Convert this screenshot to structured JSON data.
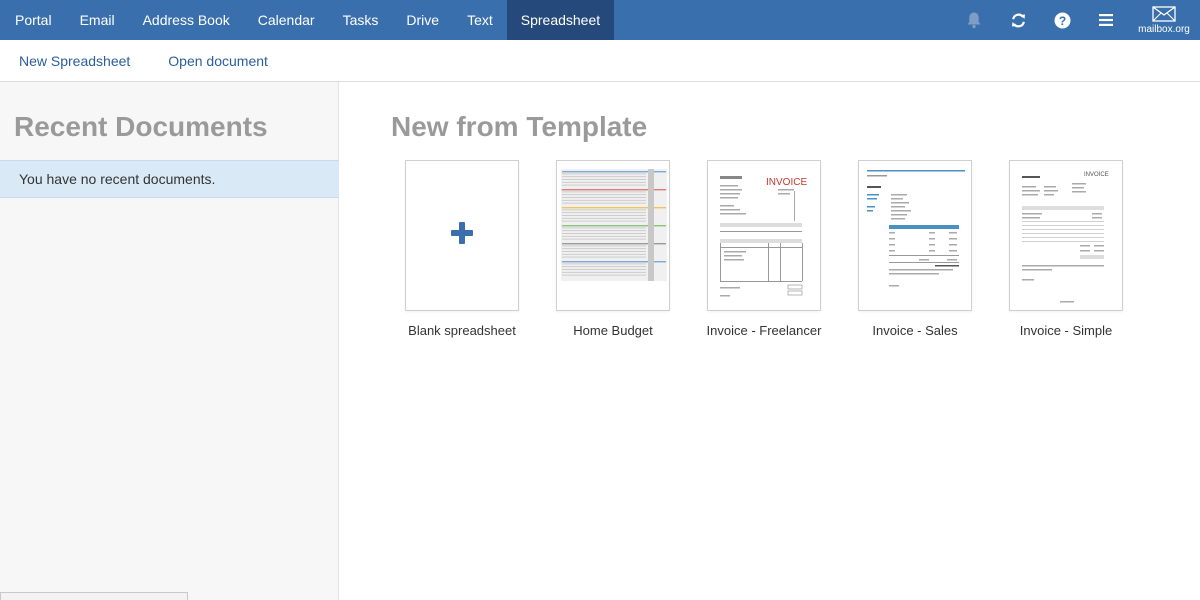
{
  "nav": {
    "items": [
      "Portal",
      "Email",
      "Address Book",
      "Calendar",
      "Tasks",
      "Drive",
      "Text",
      "Spreadsheet"
    ],
    "active": "Spreadsheet",
    "icons": [
      "bell-icon",
      "refresh-icon",
      "help-icon",
      "menu-icon"
    ],
    "brand": "mailbox.org"
  },
  "toolbar": {
    "new_spreadsheet": "New Spreadsheet",
    "open_document": "Open document"
  },
  "recent": {
    "title": "Recent Documents",
    "empty_message": "You have no recent documents."
  },
  "templates": {
    "title": "New from Template",
    "items": [
      {
        "label": "Blank spreadsheet"
      },
      {
        "label": "Home Budget"
      },
      {
        "label": "Invoice - Freelancer"
      },
      {
        "label": "Invoice - Sales"
      },
      {
        "label": "Invoice - Simple"
      }
    ],
    "thumb_text": {
      "invoice_big": "INVOICE",
      "invoice_small": "INVOICE"
    }
  },
  "colors": {
    "nav_bg": "#3a6fad",
    "nav_active": "#24497a",
    "link": "#2a5e9c",
    "heading": "#9a9a9a",
    "highlight": "#d9e9f6"
  }
}
